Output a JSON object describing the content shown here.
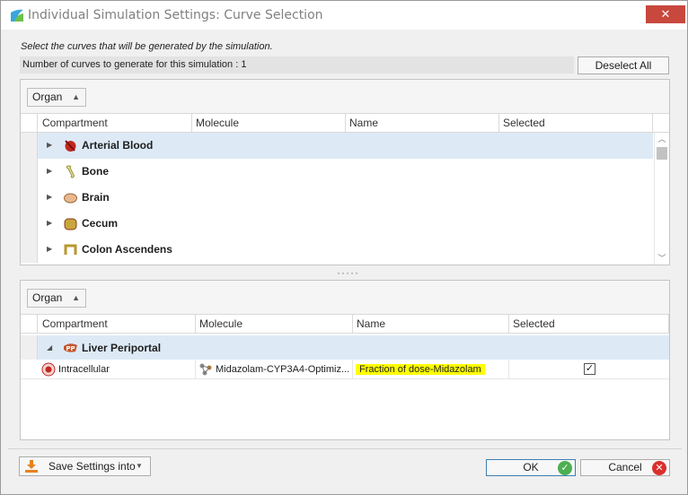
{
  "window": {
    "title": "Individual Simulation Settings: Curve Selection",
    "close_glyph": "✕"
  },
  "instruction": "Select the curves that will be generated by the simulation.",
  "curve_count_text": "Number of curves to generate for this simulation : 1",
  "buttons": {
    "deselect_all": "Deselect All",
    "save_settings": "Save Settings into",
    "ok": "OK",
    "cancel": "Cancel"
  },
  "top_panel": {
    "group_by": "Organ",
    "columns": [
      "Compartment",
      "Molecule",
      "Name",
      "Selected"
    ],
    "groups": [
      {
        "label": "Arterial Blood",
        "icon": "arterial-blood-icon",
        "selected": true
      },
      {
        "label": "Bone",
        "icon": "bone-icon",
        "selected": false
      },
      {
        "label": "Brain",
        "icon": "brain-icon",
        "selected": false
      },
      {
        "label": "Cecum",
        "icon": "cecum-icon",
        "selected": false
      },
      {
        "label": "Colon Ascendens",
        "icon": "colon-icon",
        "selected": false
      }
    ]
  },
  "splitter_glyph": "·····",
  "bottom_panel": {
    "group_by": "Organ",
    "columns": [
      "Compartment",
      "Molecule",
      "Name",
      "Selected"
    ],
    "group": {
      "label": "Liver Periportal",
      "icon": "liver-periportal-icon",
      "badge": "PP"
    },
    "rows": [
      {
        "compartment": "Intracellular",
        "molecule": "Midazolam-CYP3A4-Optimiz...",
        "name": "Fraction of dose-Midazolam",
        "selected": true,
        "check_glyph": "✓"
      }
    ]
  },
  "colors": {
    "selected_row": "#ddeaf6",
    "highlight": "#ffff00",
    "close_button": "#c8483e",
    "ok_icon": "#4caf50",
    "cancel_icon": "#d9302c"
  }
}
